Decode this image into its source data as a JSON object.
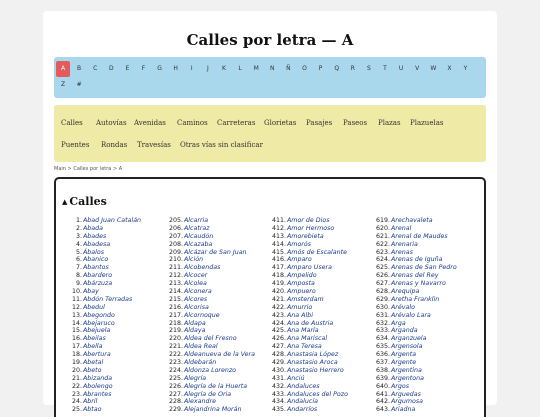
{
  "title": "Calles por letra — A",
  "letters": [
    "A",
    "B",
    "C",
    "D",
    "E",
    "F",
    "G",
    "H",
    "I",
    "J",
    "K",
    "L",
    "M",
    "N",
    "Ñ",
    "O",
    "P",
    "Q",
    "R",
    "S",
    "T",
    "U",
    "V",
    "W",
    "X",
    "Y",
    "Z",
    "#"
  ],
  "categories": [
    [
      "Calles",
      "Autovías",
      "Avenidas",
      "Caminos",
      "Carreteras",
      "Glorietas",
      "Pasajes",
      "Paseos",
      "Plazas",
      "Plazuelas"
    ],
    [
      "Puentes",
      "Rondas",
      "Travesías",
      "Otras vías sin clasificar"
    ]
  ],
  "breadcrumb": {
    "home": "Main",
    "sep1": ">",
    "section": "Calles por letra",
    "sep2": ">",
    "current": "A"
  },
  "section_title": "Calles",
  "columns": [
    [
      [
        "1.",
        "Abad Juan Catalán"
      ],
      [
        "2.",
        "Abada"
      ],
      [
        "3.",
        "Abades"
      ],
      [
        "4.",
        "Abadesa"
      ],
      [
        "5.",
        "Ábalos"
      ],
      [
        "6.",
        "Abanico"
      ],
      [
        "7.",
        "Abantos"
      ],
      [
        "8.",
        "Abardero"
      ],
      [
        "9.",
        "Abárzuza"
      ],
      [
        "10.",
        "Abay"
      ],
      [
        "11.",
        "Abdón Terradas"
      ],
      [
        "12.",
        "Abedul"
      ],
      [
        "13.",
        "Abegondo"
      ],
      [
        "14.",
        "Abejaruco"
      ],
      [
        "15.",
        "Abejuela"
      ],
      [
        "16.",
        "Abeilas"
      ],
      [
        "17.",
        "Abella"
      ],
      [
        "18.",
        "Abertura"
      ],
      [
        "19.",
        "Abetal"
      ],
      [
        "20.",
        "Abeto"
      ],
      [
        "21.",
        "Abizanda"
      ],
      [
        "22.",
        "Abolengo"
      ],
      [
        "23.",
        "Abrantes"
      ],
      [
        "24.",
        "Abril"
      ],
      [
        "25.",
        "Abtao"
      ]
    ],
    [
      [
        "205.",
        "Alcarria"
      ],
      [
        "206.",
        "Alcatraz"
      ],
      [
        "207.",
        "Alcaudón"
      ],
      [
        "208.",
        "Alcazaba"
      ],
      [
        "209.",
        "Alcázar de San Juan"
      ],
      [
        "210.",
        "Alción"
      ],
      [
        "211.",
        "Alcobendas"
      ],
      [
        "212.",
        "Alcocer"
      ],
      [
        "213.",
        "Alcolea"
      ],
      [
        "214.",
        "Alconera"
      ],
      [
        "215.",
        "Alcores"
      ],
      [
        "216.",
        "Alcorisa"
      ],
      [
        "217.",
        "Alcornoque"
      ],
      [
        "218.",
        "Aldapa"
      ],
      [
        "219.",
        "Aldaya"
      ],
      [
        "220.",
        "Aldea del Fresno"
      ],
      [
        "221.",
        "Aldea Real"
      ],
      [
        "222.",
        "Aldeanueva de la Vera"
      ],
      [
        "223.",
        "Aldebarán"
      ],
      [
        "224.",
        "Aldonza Lorenzo"
      ],
      [
        "225.",
        "Alegría"
      ],
      [
        "226.",
        "Alegría de la Huerta"
      ],
      [
        "227.",
        "Alegría de Oria"
      ],
      [
        "228.",
        "Alexandre"
      ],
      [
        "229.",
        "Alejandrina Morán"
      ]
    ],
    [
      [
        "411.",
        "Amor de Dios"
      ],
      [
        "412.",
        "Amor Hermoso"
      ],
      [
        "413.",
        "Amorebieta"
      ],
      [
        "414.",
        "Amorós"
      ],
      [
        "415.",
        "Amós de Escalante"
      ],
      [
        "416.",
        "Amparo"
      ],
      [
        "417.",
        "Amparo Usera"
      ],
      [
        "418.",
        "Ampelido"
      ],
      [
        "419.",
        "Amposta"
      ],
      [
        "420.",
        "Ampuero"
      ],
      [
        "421.",
        "Amsterdam"
      ],
      [
        "422.",
        "Amurrio"
      ],
      [
        "423.",
        "Ana Albi"
      ],
      [
        "424.",
        "Ana de Austria"
      ],
      [
        "425.",
        "Ana María"
      ],
      [
        "426.",
        "Ana Mariscal"
      ],
      [
        "427.",
        "Ana Teresa"
      ],
      [
        "428.",
        "Anastasia López"
      ],
      [
        "429.",
        "Anastasio Aroca"
      ],
      [
        "430.",
        "Anastasio Herrero"
      ],
      [
        "431.",
        "Anciú"
      ],
      [
        "432.",
        "Andaluces"
      ],
      [
        "433.",
        "Andaluces del Pozo"
      ],
      [
        "434.",
        "Andalucía"
      ],
      [
        "435.",
        "Andarríos"
      ]
    ],
    [
      [
        "619.",
        "Arechavaleta"
      ],
      [
        "620.",
        "Arenal"
      ],
      [
        "621.",
        "Arenal de Maudes"
      ],
      [
        "622.",
        "Arenaria"
      ],
      [
        "623.",
        "Arenas"
      ],
      [
        "624.",
        "Arenas de Iguña"
      ],
      [
        "625.",
        "Arenas de San Pedro"
      ],
      [
        "626.",
        "Arenas del Rey"
      ],
      [
        "627.",
        "Arenas y Navarro"
      ],
      [
        "628.",
        "Arequipa"
      ],
      [
        "629.",
        "Aretha Franklin"
      ],
      [
        "630.",
        "Arévalo"
      ],
      [
        "631.",
        "Arévalo Lara"
      ],
      [
        "632.",
        "Arga"
      ],
      [
        "633.",
        "Arganda"
      ],
      [
        "634.",
        "Arganzuela"
      ],
      [
        "635.",
        "Argensola"
      ],
      [
        "636.",
        "Argenta"
      ],
      [
        "637.",
        "Argente"
      ],
      [
        "638.",
        "Argentina"
      ],
      [
        "639.",
        "Argentona"
      ],
      [
        "640.",
        "Argos"
      ],
      [
        "641.",
        "Arguedas"
      ],
      [
        "642.",
        "Argumosa"
      ],
      [
        "643.",
        "Ariadna"
      ]
    ]
  ],
  "colors": {
    "letters_bg": "#a9d8ec",
    "active_letter": "#e45b5b",
    "categories_bg": "#efeaa5",
    "link": "#1a3a8a"
  }
}
